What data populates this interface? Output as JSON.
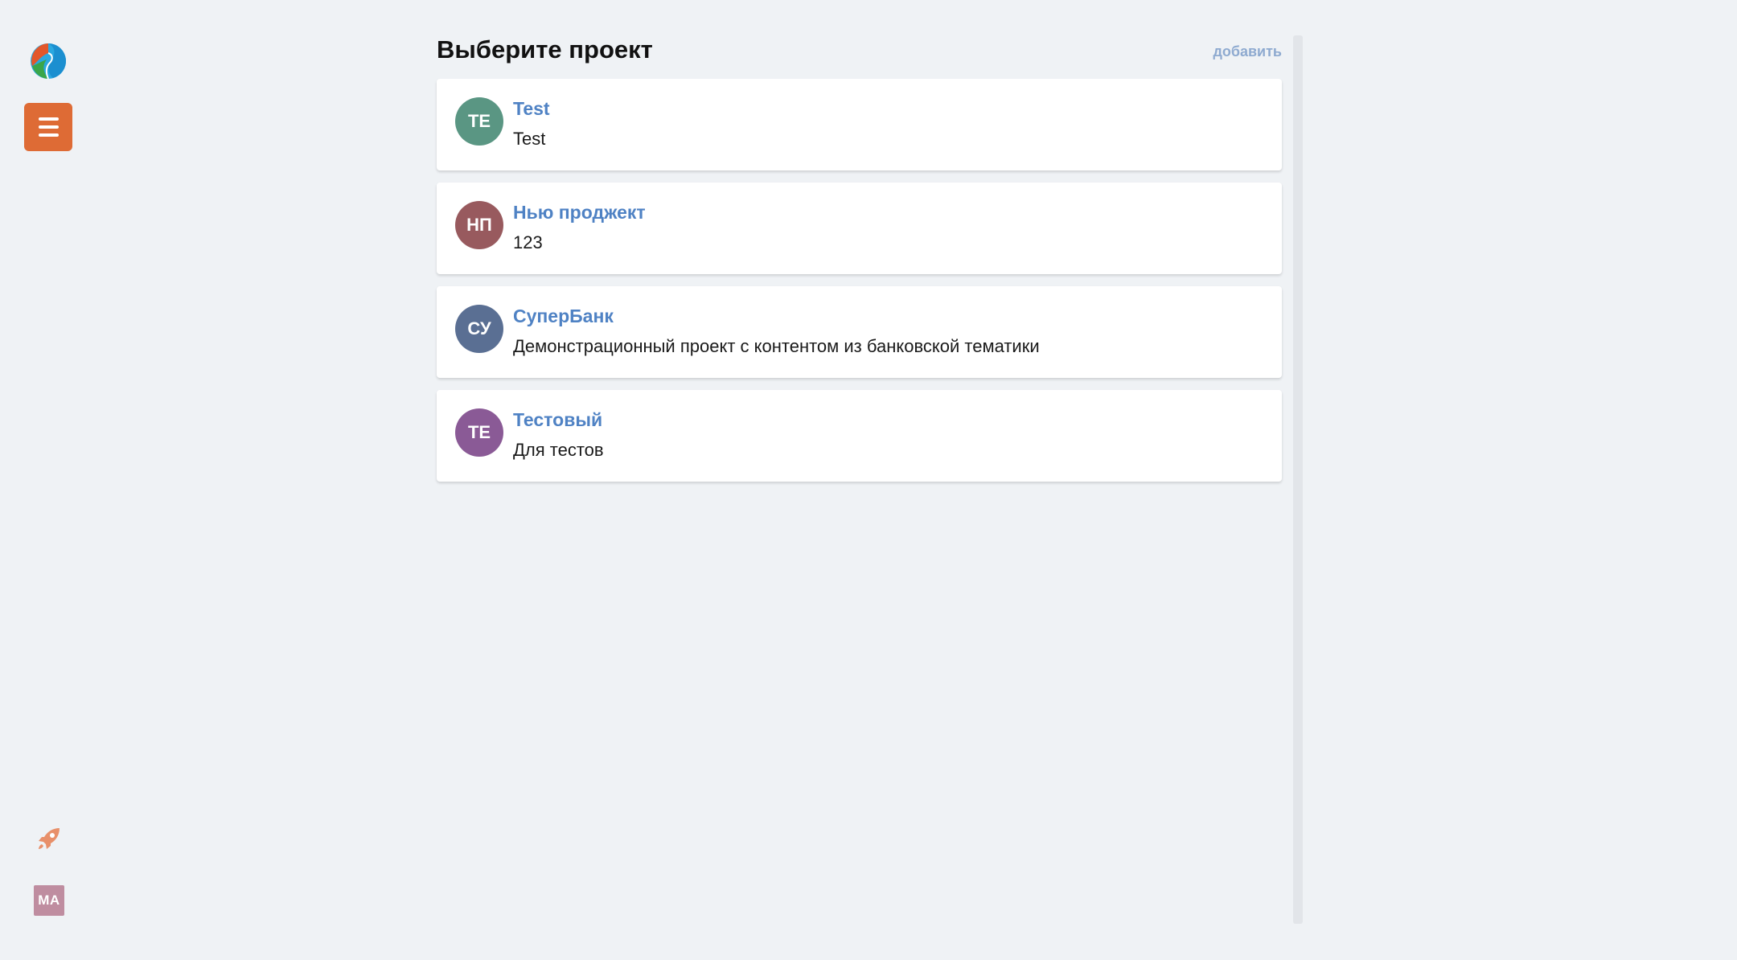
{
  "header": {
    "title": "Выберите проект",
    "add_label": "добавить"
  },
  "sidebar": {
    "logo_icon": "app-logo-icon",
    "menu_icon": "hamburger-menu-icon",
    "menu_color": "#de6b35",
    "rocket_icon": "rocket-icon",
    "user_initials": "MA",
    "user_color": "#bf8da0"
  },
  "projects": [
    {
      "initials": "TE",
      "name": "Test",
      "description": "Test",
      "color": "#5a9683"
    },
    {
      "initials": "НП",
      "name": "Нью проджект",
      "description": "123",
      "color": "#985a5e"
    },
    {
      "initials": "СУ",
      "name": "СуперБанк",
      "description": "Демонстрационный проект с контентом из банковской тематики",
      "color": "#5a6f93"
    },
    {
      "initials": "ТЕ",
      "name": "Тестовый",
      "description": "Для тестов",
      "color": "#8a5a96"
    }
  ],
  "colors": {
    "background": "#eff2f5",
    "link": "#4f82c4",
    "add_link": "#8eaad0"
  }
}
